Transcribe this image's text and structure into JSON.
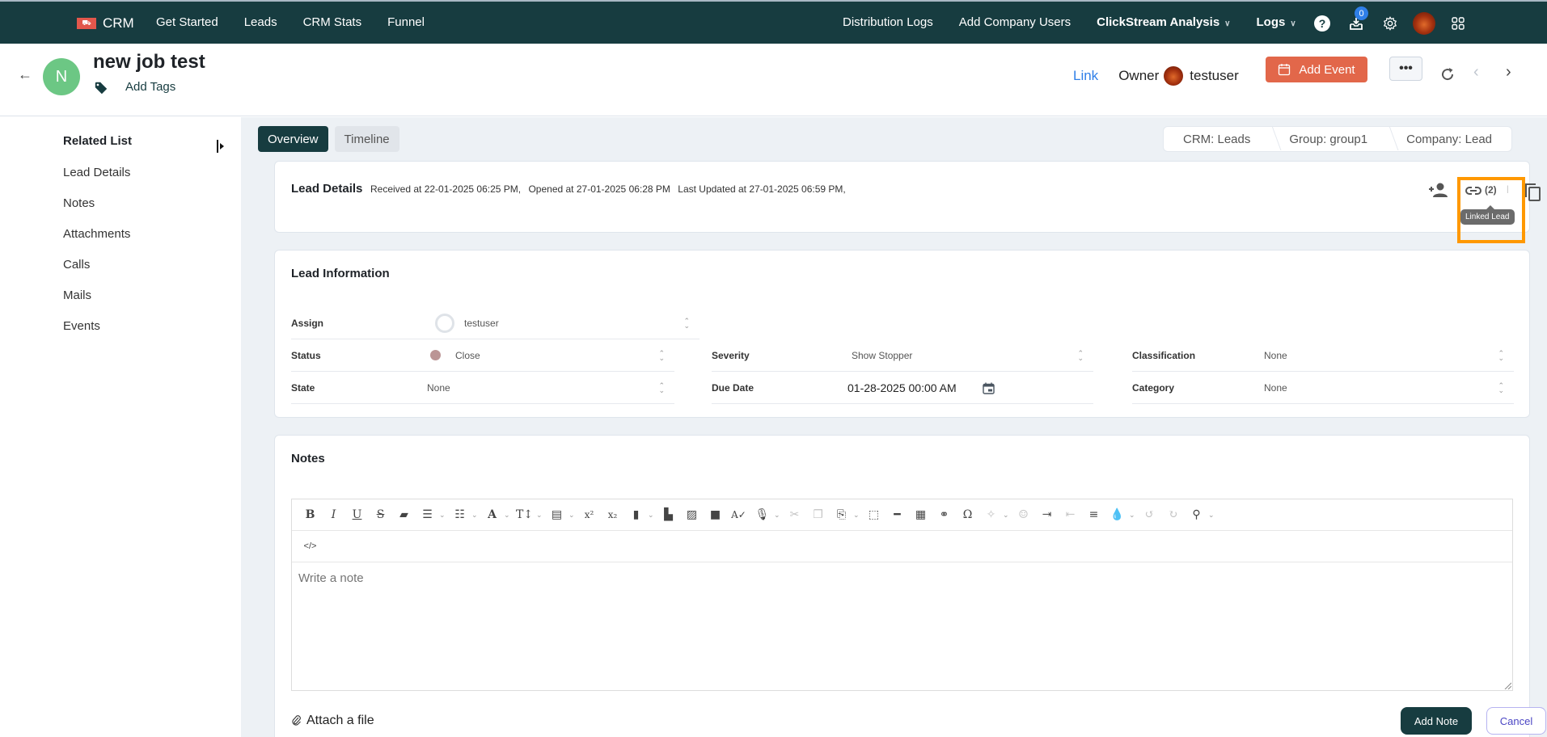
{
  "topnav": {
    "logo_text": "CRM",
    "left_items": [
      "Get Started",
      "Leads",
      "CRM Stats",
      "Funnel"
    ],
    "right_items": [
      {
        "label": "Distribution Logs",
        "dropdown": false
      },
      {
        "label": "Add Company Users",
        "dropdown": false
      },
      {
        "label": "ClickStream Analysis",
        "dropdown": true
      },
      {
        "label": "Logs",
        "dropdown": true
      }
    ],
    "help_glyph": "?",
    "notification_count": "0"
  },
  "header": {
    "back_glyph": "←",
    "avatar_letter": "N",
    "title": "new job test",
    "add_tags": "Add Tags",
    "link_label": "Link",
    "owner_label": "Owner",
    "owner_name": "testuser",
    "add_event_label": "Add Event",
    "more_glyph": "•••",
    "prev_glyph": "‹",
    "next_glyph": "›"
  },
  "sidebar": {
    "title": "Related List",
    "items": [
      "Lead Details",
      "Notes",
      "Attachments",
      "Calls",
      "Mails",
      "Events"
    ]
  },
  "main": {
    "tabs": [
      {
        "label": "Overview",
        "active": true
      },
      {
        "label": "Timeline",
        "active": false
      }
    ],
    "breadcrumbs": [
      "CRM: Leads",
      "Group: group1",
      "Company: Lead"
    ],
    "lead_details": {
      "title": "Lead Details",
      "received": "Received at 22-01-2025 06:25 PM,",
      "opened": "Opened at 27-01-2025 06:28 PM",
      "updated": "Last Updated at 27-01-2025 06:59 PM,",
      "linked_count": "(2)",
      "linked_tooltip": "Linked Lead"
    },
    "lead_information": {
      "title": "Lead Information",
      "assign": {
        "label": "Assign",
        "value": "testuser"
      },
      "status": {
        "label": "Status",
        "value": "Close",
        "color": "#bb9595"
      },
      "state": {
        "label": "State",
        "value": "None"
      },
      "severity": {
        "label": "Severity",
        "value": "Show Stopper"
      },
      "due_date": {
        "label": "Due Date",
        "value": "01-28-2025 00:00 AM"
      },
      "classification": {
        "label": "Classification",
        "value": "None"
      },
      "category": {
        "label": "Category",
        "value": "None"
      }
    },
    "notes": {
      "title": "Notes",
      "placeholder": "Write a note",
      "code_view": "</>",
      "attach_label": "Attach a file",
      "add_note_label": "Add Note",
      "cancel_label": "Cancel"
    }
  },
  "colors": {
    "nav_bg": "#173c40",
    "accent_orange": "#e2674a",
    "link_blue": "#2f7fe8",
    "highlight": "#ff9800"
  }
}
